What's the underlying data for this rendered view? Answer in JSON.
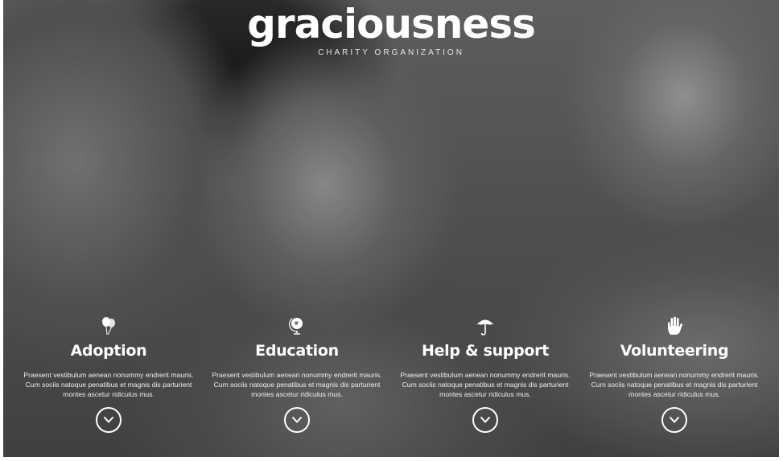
{
  "brand": {
    "name": "graciousness",
    "tagline": "CHARITY ORGANIZATION"
  },
  "features": [
    {
      "icon": "balloons-icon",
      "title": "Adoption",
      "description": "Praesent vestibulum aenean nonummy endrerit mauris. Cum sociis natoque penatibus et magnis dis parturient montes ascetur ridiculus mus."
    },
    {
      "icon": "globe-icon",
      "title": "Education",
      "description": "Praesent vestibulum aenean nonummy endrerit mauris. Cum sociis natoque penatibus et magnis dis parturient montes ascetur ridiculus mus."
    },
    {
      "icon": "umbrella-icon",
      "title": "Help & support",
      "description": "Praesent vestibulum aenean nonummy endrerit mauris. Cum sociis natoque penatibus et magnis dis parturient montes ascetur ridiculus mus."
    },
    {
      "icon": "hand-icon",
      "title": "Volunteering",
      "description": "Praesent vestibulum aenean nonummy endrerit mauris. Cum sociis natoque penatibus et magnis dis parturient montes ascetur ridiculus mus."
    }
  ],
  "colors": {
    "text": "#ffffff",
    "overlay": "#3a3a3a"
  },
  "more_button_icon": "chevron-down-icon"
}
